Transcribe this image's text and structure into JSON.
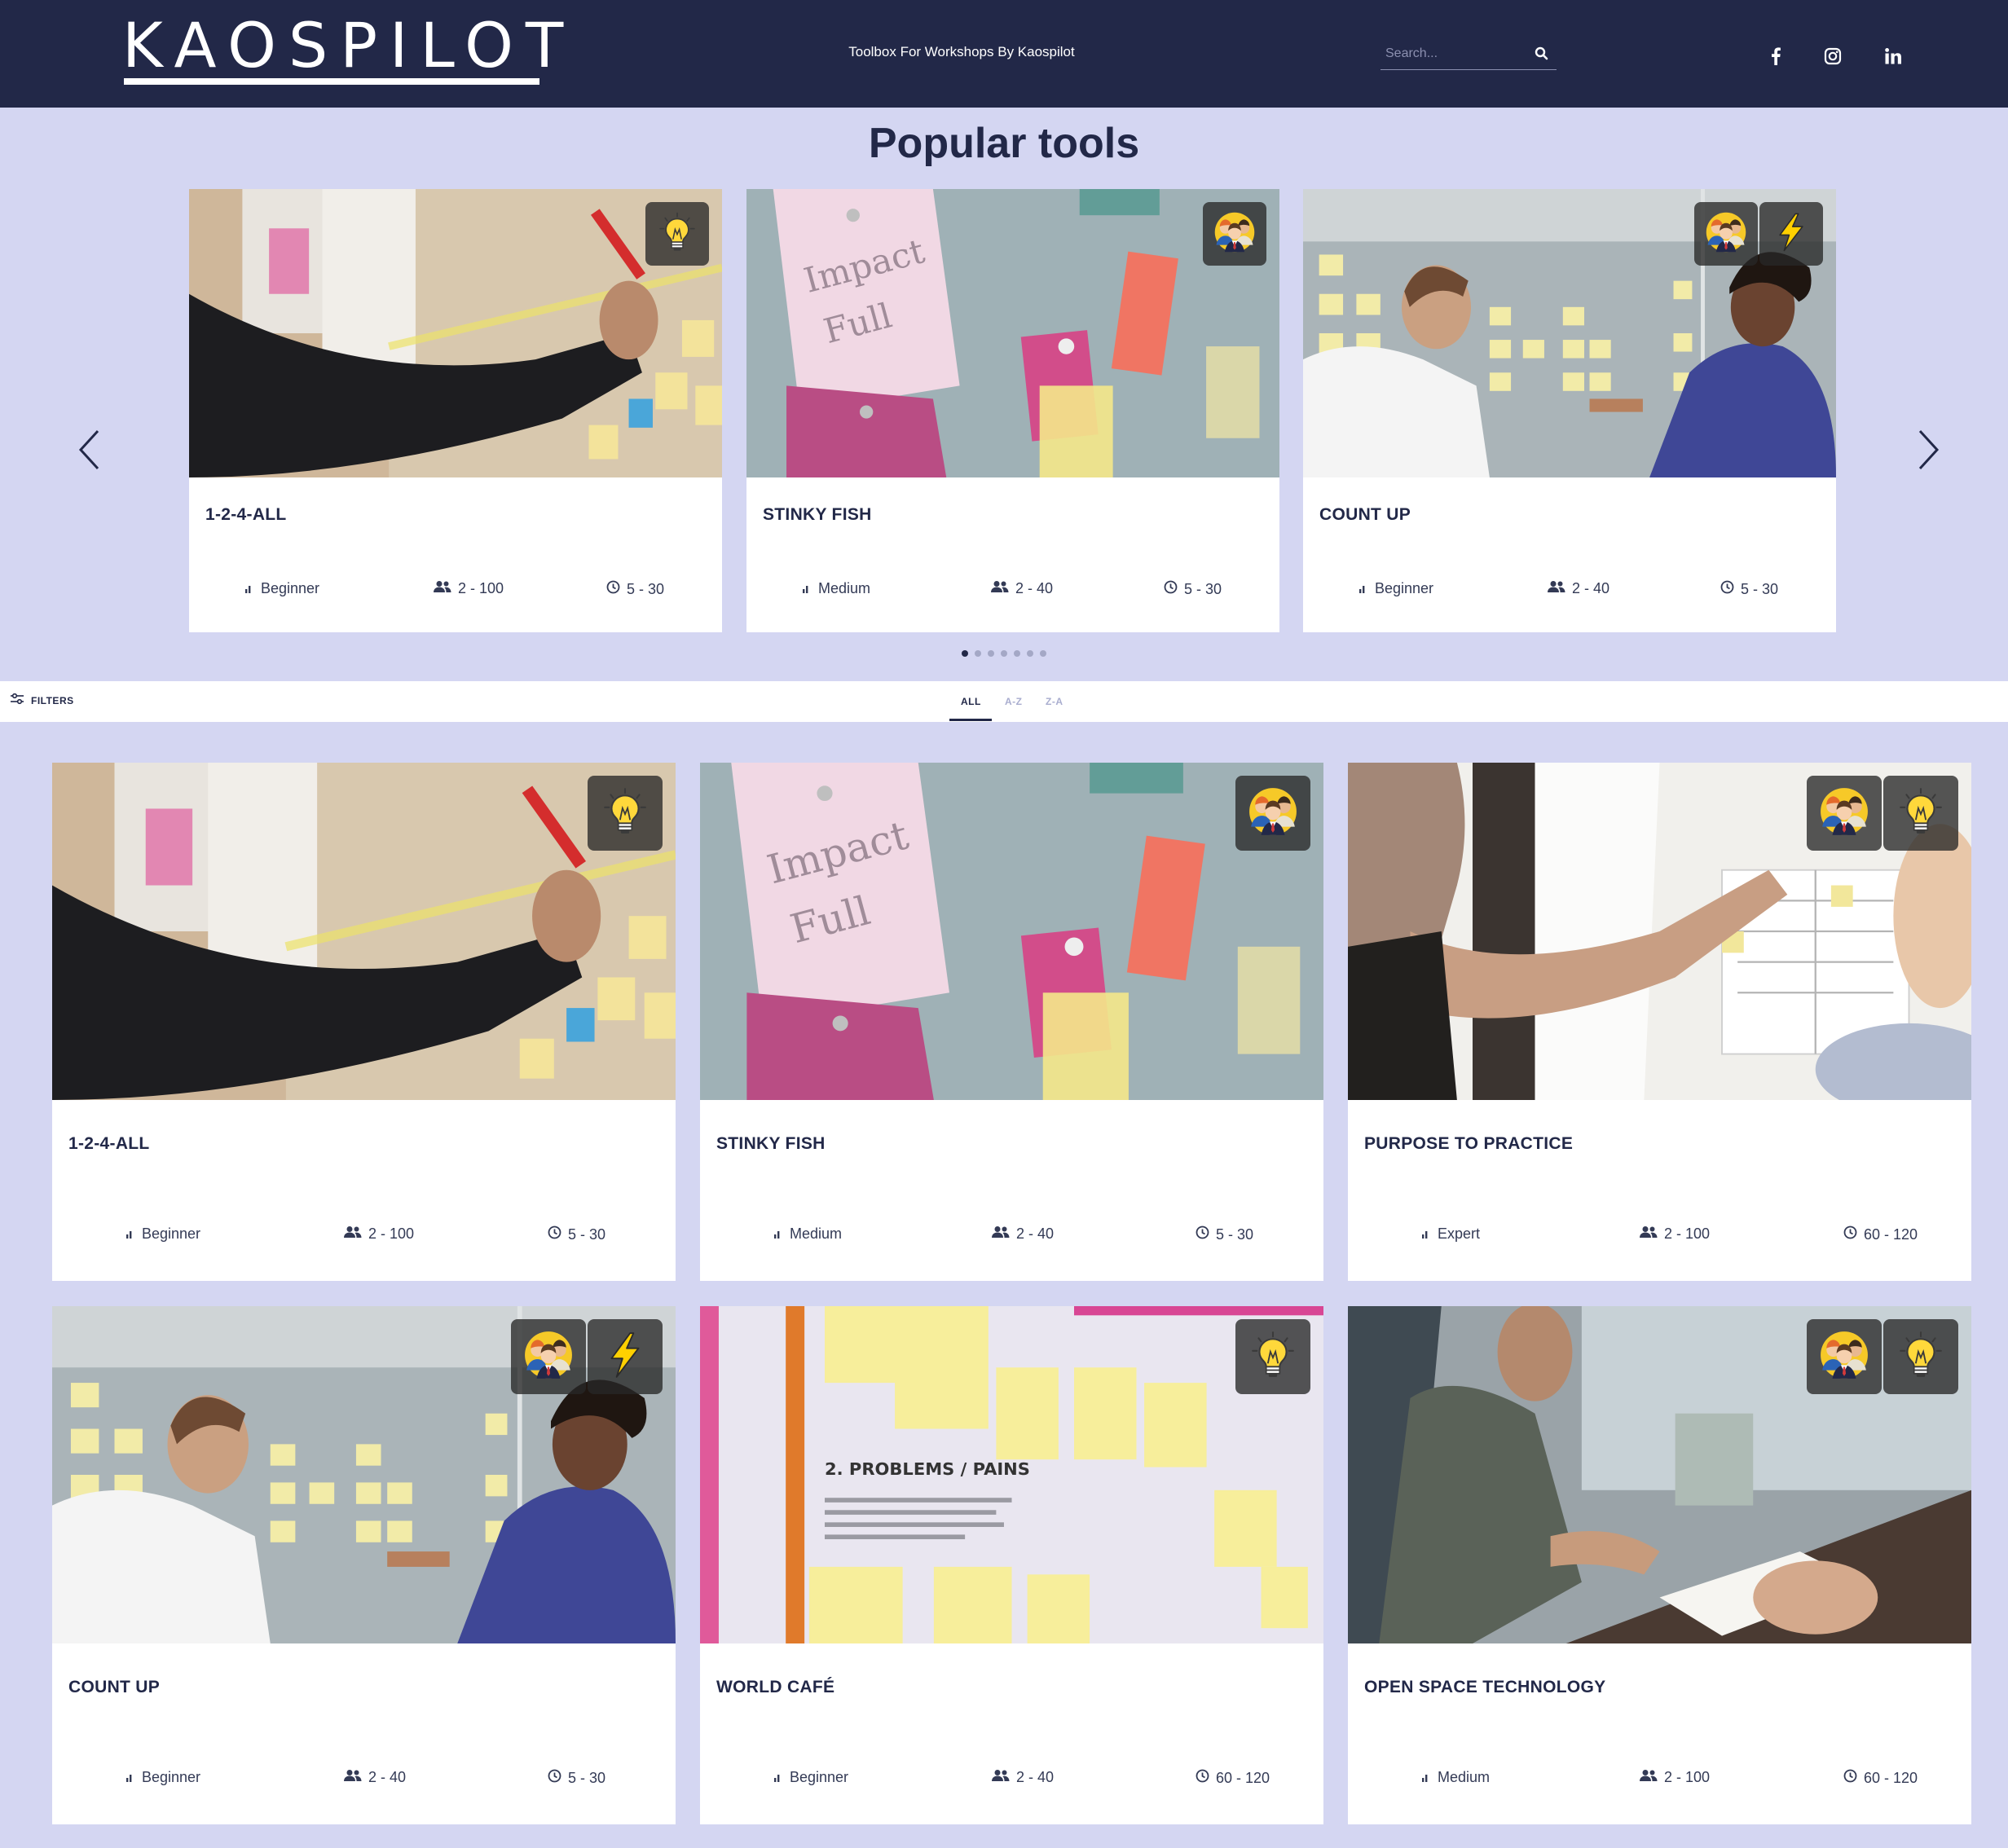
{
  "header": {
    "logo": "KAOSPILOT",
    "tagline": "Toolbox For Workshops By Kaospilot",
    "search_placeholder": "Search..."
  },
  "popular": {
    "title": "Popular tools",
    "cards": [
      {
        "title": "1-2-4-ALL",
        "level": "Beginner",
        "people": "2 - 100",
        "time": "5 - 30"
      },
      {
        "title": "STINKY FISH",
        "level": "Medium",
        "people": "2 - 40",
        "time": "5 - 30"
      },
      {
        "title": "COUNT UP",
        "level": "Beginner",
        "people": "2 - 40",
        "time": "5 - 30"
      }
    ]
  },
  "filterbar": {
    "filters_label": "FILTERS",
    "tabs": [
      "ALL",
      "A-Z",
      "Z-A"
    ]
  },
  "grid": {
    "cards": [
      {
        "title": "1-2-4-ALL",
        "level": "Beginner",
        "people": "2 - 100",
        "time": "5 - 30"
      },
      {
        "title": "STINKY FISH",
        "level": "Medium",
        "people": "2 - 40",
        "time": "5 - 30"
      },
      {
        "title": "PURPOSE TO PRACTICE",
        "level": "Expert",
        "people": "2 - 100",
        "time": "60 - 120"
      },
      {
        "title": "COUNT UP",
        "level": "Beginner",
        "people": "2 - 40",
        "time": "5 - 30"
      },
      {
        "title": "WORLD CAFÉ",
        "level": "Beginner",
        "people": "2 - 40",
        "time": "60 - 120"
      },
      {
        "title": "OPEN SPACE TECHNOLOGY",
        "level": "Medium",
        "people": "2 - 100",
        "time": "60 - 120"
      }
    ]
  },
  "icons": {
    "social": [
      "facebook-icon",
      "instagram-icon",
      "linkedin-icon"
    ],
    "badge_types": [
      "lightbulb-icon",
      "team-icon",
      "lightning-icon"
    ]
  },
  "colors": {
    "header_bg": "#222848",
    "page_bg": "#d4d6f2",
    "accent": "#222848"
  }
}
